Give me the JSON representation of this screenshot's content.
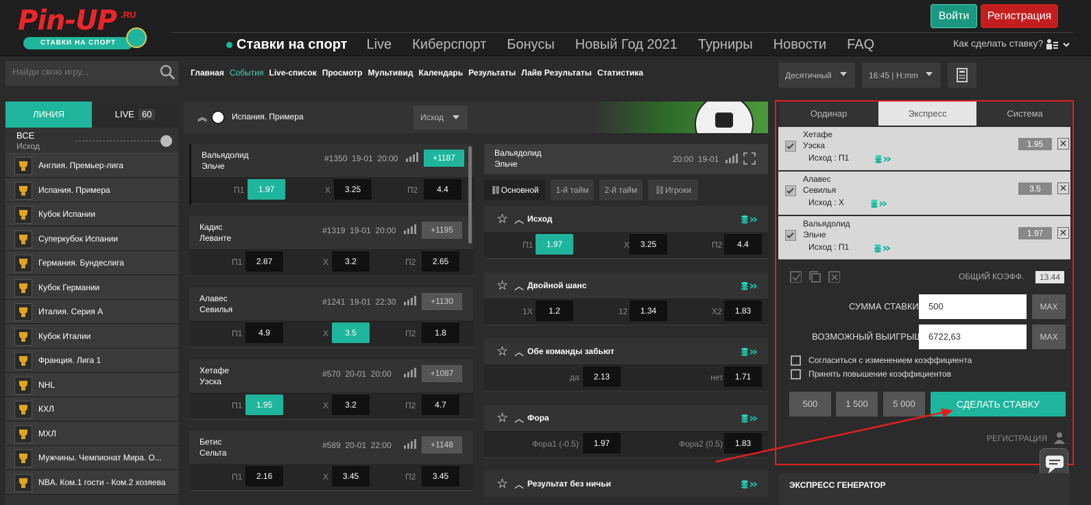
{
  "brand": {
    "name": "Pin-UP",
    "tld": ".RU",
    "tagline": "СТАВКИ НА СПОРТ",
    "logo_color": "#e8262b",
    "accent": "#1fb59d"
  },
  "header": {
    "login": "Войти",
    "register": "Регистрация",
    "how_to": "Как сделать ставку?"
  },
  "nav": [
    "Ставки на спорт",
    "Live",
    "Киберспорт",
    "Бонусы",
    "Новый Год 2021",
    "Турниры",
    "Новости",
    "FAQ"
  ],
  "search": {
    "placeholder": "Найди свою игру..."
  },
  "subnav": [
    "Главная",
    "События",
    "Live-список",
    "Просмотр",
    "Мультивид",
    "Календарь",
    "Результаты",
    "Лайв Результаты",
    "Статистика"
  ],
  "subnav_active": "События",
  "format": {
    "odds": "Десятичный",
    "time": "16:45 | H:mm"
  },
  "sidebar": {
    "tab_line": "ЛИНИЯ",
    "tab_live": "LIVE",
    "live_count": "60",
    "all_label": "ВСЕ",
    "all_sub": "Исход",
    "leagues": [
      "Англия. Премьер-лига",
      "Испания. Примера",
      "Кубок Испании",
      "Суперкубок Испании",
      "Германия. Бундеслига",
      "Кубок Германии",
      "Италия. Серия А",
      "Кубок Италии",
      "Франция. Лига 1",
      "NHL",
      "КХЛ",
      "МХЛ",
      "Мужчины. Чемпионат Мира. О...",
      "NBA. Ком.1 гости - Ком.2 хозяева"
    ]
  },
  "main": {
    "league_title": "Испания. Примера",
    "market_select": "Исход",
    "matches": [
      {
        "home": "Вальядолид",
        "away": "Эльче",
        "id": "#1350",
        "date": "19-01",
        "time": "20:00",
        "more": "+1187",
        "p1": "1.97",
        "x": "3.25",
        "p2": "4.4",
        "sel": "p1",
        "more_active": true
      },
      {
        "home": "Кадис",
        "away": "Леванте",
        "id": "#1319",
        "date": "19-01",
        "time": "20:00",
        "more": "+1195",
        "p1": "2.87",
        "x": "3.2",
        "p2": "2.65",
        "sel": "",
        "more_active": false
      },
      {
        "home": "Алавес",
        "away": "Севилья",
        "id": "#1241",
        "date": "19-01",
        "time": "22:30",
        "more": "+1130",
        "p1": "4.9",
        "x": "3.5",
        "p2": "1.8",
        "sel": "x",
        "more_active": false
      },
      {
        "home": "Хетафе",
        "away": "Уэска",
        "id": "#570",
        "date": "20-01",
        "time": "20:00",
        "more": "+1087",
        "p1": "1.95",
        "x": "3.2",
        "p2": "4.7",
        "sel": "p1",
        "more_active": false
      },
      {
        "home": "Бетис",
        "away": "Сельта",
        "id": "#589",
        "date": "20-01",
        "time": "22:00",
        "more": "+1148",
        "p1": "2.16",
        "x": "3.45",
        "p2": "3.45",
        "sel": "",
        "more_active": false
      }
    ],
    "labels": {
      "p1": "П1",
      "x": "Х",
      "p2": "П2"
    }
  },
  "market": {
    "home": "Вальядолид",
    "away": "Эльче",
    "time": "20:00",
    "date": "19-01",
    "tabs": [
      "Основной",
      "1-й тайм",
      "2-й тайм",
      "Игроки"
    ],
    "blocks": [
      {
        "name": "Исход",
        "l1": "П1",
        "v1": "1.97",
        "l2": "Х",
        "v2": "3.25",
        "l3": "П2",
        "v3": "4.4",
        "sel": 1
      },
      {
        "name": "Двойной шанс",
        "l1": "1Х",
        "v1": "1.2",
        "l2": "12",
        "v2": "1.34",
        "l3": "Х2",
        "v3": "1.83",
        "sel": 0
      },
      {
        "name": "Обе команды забьют",
        "l1": "да",
        "v1": "2.13",
        "l3": "нет",
        "v3": "1.71",
        "sel": 0
      },
      {
        "name": "Фора",
        "l1": "Фора1 (-0.5)",
        "v1": "1.97",
        "l3": "Фора2 (0.5)",
        "v3": "1.83",
        "sel": 0
      },
      {
        "name": "Результат без ничьи"
      }
    ]
  },
  "slip": {
    "tabs": [
      "Ординар",
      "Экспресс",
      "Система"
    ],
    "bets": [
      {
        "home": "Хетафе",
        "away": "Уэска",
        "outcome": "Исход : П1",
        "coef": "1.95"
      },
      {
        "home": "Алавес",
        "away": "Севилья",
        "outcome": "Исход : Х",
        "coef": "3.5"
      },
      {
        "home": "Вальядолид",
        "away": "Эльче",
        "outcome": "Исход : П1",
        "coef": "1.97"
      }
    ],
    "total_label": "ОБЩИЙ КОЭФФ.",
    "total": "13.44",
    "stake_label": "СУММА СТАВКИ",
    "stake": "500",
    "win_label": "ВОЗМОЖНЫЙ ВЫИГРЫШ",
    "win": "6722,63",
    "max": "MAX",
    "accept_change": "Согласиться с изменением коэффициента",
    "accept_raise": "Принять повышение коэффициентов",
    "quick": [
      "500",
      "1 500",
      "5 000"
    ],
    "place": "СДЕЛАТЬ СТАВКУ",
    "register": "РЕГИСТРАЦИЯ",
    "express_gen": "ЭКСПРЕСС ГЕНЕРАТОР"
  }
}
